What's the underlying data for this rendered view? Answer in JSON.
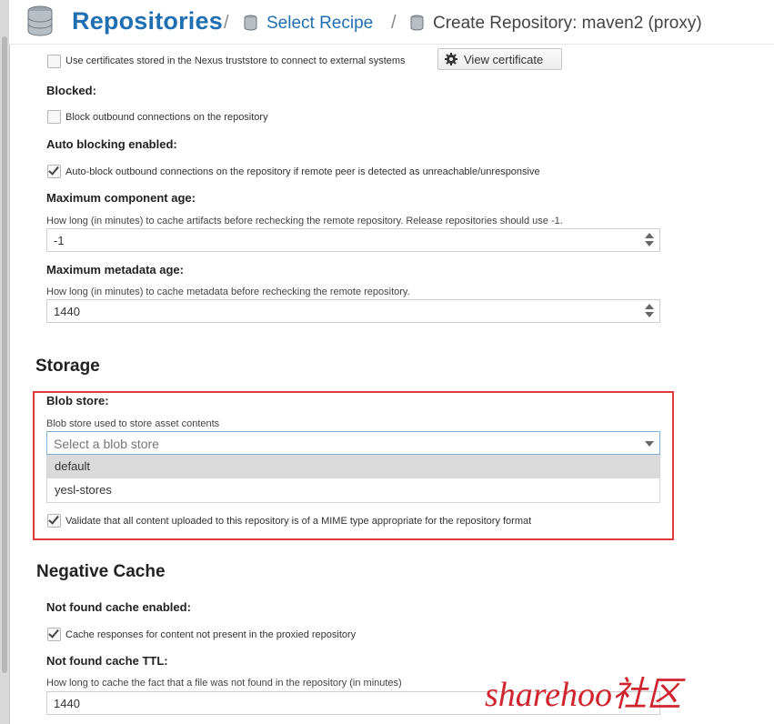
{
  "breadcrumb": {
    "root": "Repositories",
    "separator": "/",
    "link": "Select Recipe",
    "current": "Create Repository: maven2 (proxy)"
  },
  "https": {
    "truststore_label": "Use certificates stored in the Nexus truststore to connect to external systems",
    "truststore_checked": false,
    "view_certificate": "View certificate"
  },
  "blocked": {
    "label": "Blocked:",
    "checkbox_label": "Block outbound connections on the repository",
    "checked": false
  },
  "auto_blocking": {
    "label": "Auto blocking enabled:",
    "checkbox_label": "Auto-block outbound connections on the repository if remote peer is detected as unreachable/unresponsive",
    "checked": true
  },
  "max_component_age": {
    "label": "Maximum component age:",
    "help": "How long (in minutes) to cache artifacts before rechecking the remote repository. Release repositories should use -1.",
    "value": "-1"
  },
  "max_metadata_age": {
    "label": "Maximum metadata age:",
    "help": "How long (in minutes) to cache metadata before rechecking the remote repository.",
    "value": "1440"
  },
  "storage": {
    "title": "Storage",
    "blob_label": "Blob store:",
    "blob_help": "Blob store used to store asset contents",
    "blob_placeholder": "Select a blob store",
    "blob_options": [
      "default",
      "yesl-stores"
    ],
    "highlighted_option": "default",
    "validate_label": "Validate that all content uploaded to this repository is of a MIME type appropriate for the repository format",
    "validate_checked": true
  },
  "negative_cache": {
    "title": "Negative Cache",
    "enabled_label": "Not found cache enabled:",
    "enabled_checkbox_label": "Cache responses for content not present in the proxied repository",
    "enabled_checked": true,
    "ttl_label": "Not found cache TTL:",
    "ttl_help": "How long to cache the fact that a file was not found in the repository (in minutes)",
    "ttl_value": "1440"
  },
  "watermark": "sharehoo社区",
  "colors": {
    "accent": "#1f6fb2",
    "highlight_border": "#e03b3b",
    "watermark": "#d0252f"
  }
}
